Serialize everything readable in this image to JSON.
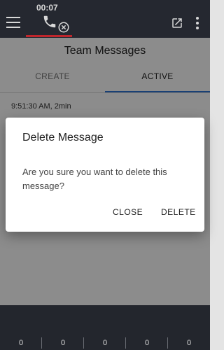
{
  "topbar": {
    "call_time": "00:07",
    "icons": [
      "menu-icon",
      "phone-icon",
      "hangup-icon",
      "popout-icon",
      "more-vert-icon"
    ],
    "accent": "#c0262c"
  },
  "page": {
    "title": "Team Messages",
    "tabs": [
      {
        "label": "CREATE",
        "selected": false
      },
      {
        "label": "ACTIVE",
        "selected": true
      }
    ],
    "tab_indicator_color": "#2f75d6",
    "messages": [
      {
        "time": "9:51:30 AM, 2min"
      }
    ]
  },
  "dialog": {
    "title": "Delete Message",
    "body": "Are you sure you want to delete this message?",
    "close_label": "CLOSE",
    "delete_label": "DELETE"
  },
  "bottombar": {
    "counters": [
      "0",
      "0",
      "0",
      "0",
      "0"
    ]
  }
}
